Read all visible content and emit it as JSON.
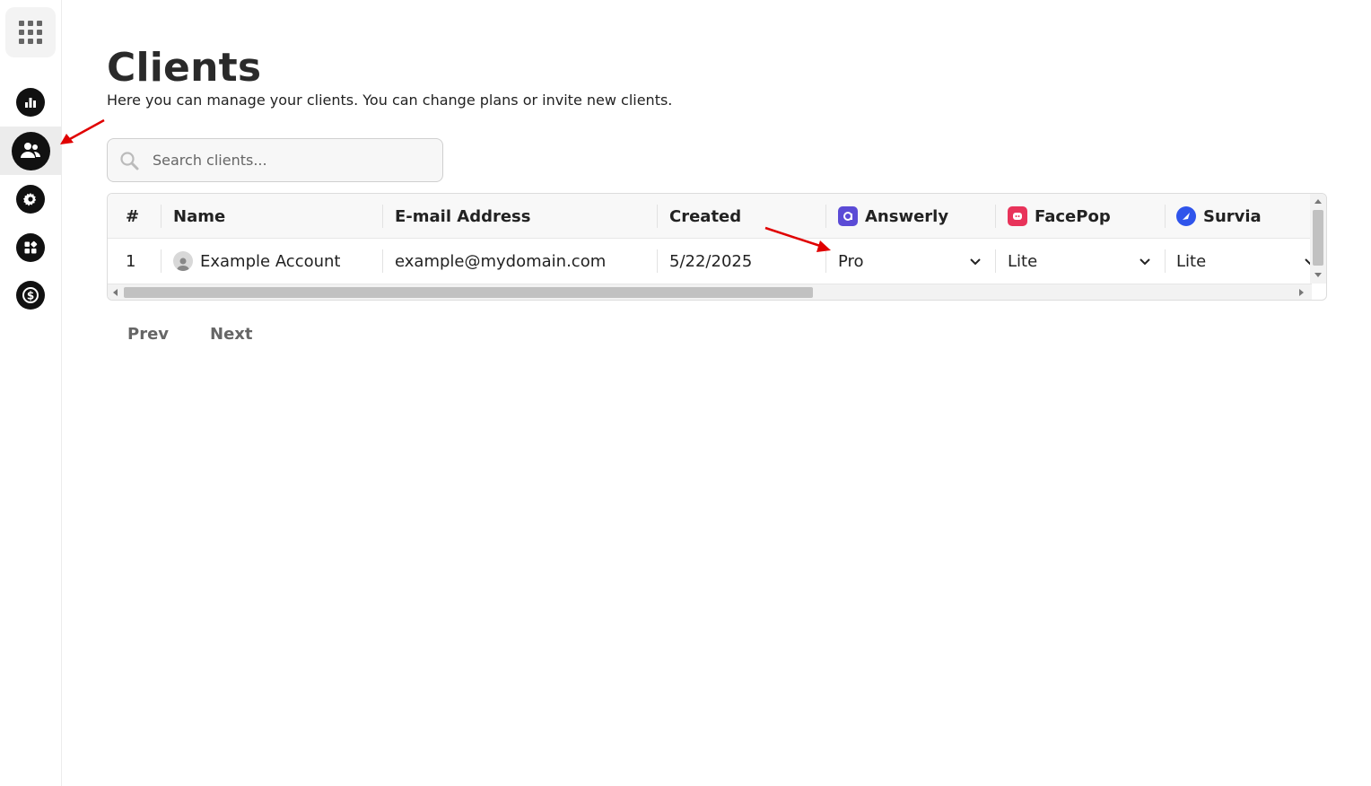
{
  "sidebar": {
    "items": [
      {
        "name": "analytics",
        "icon": "bar-chart-icon"
      },
      {
        "name": "clients",
        "icon": "users-icon",
        "active": true
      },
      {
        "name": "settings",
        "icon": "gear-icon"
      },
      {
        "name": "apps",
        "icon": "widgets-icon"
      },
      {
        "name": "billing",
        "icon": "dollar-icon"
      }
    ]
  },
  "page": {
    "title": "Clients",
    "subtitle": "Here you can manage your clients. You can change plans or invite new clients."
  },
  "search": {
    "placeholder": "Search clients..."
  },
  "table": {
    "headers": {
      "index": "#",
      "name": "Name",
      "email": "E-mail Address",
      "created": "Created",
      "answerly": "Answerly",
      "facepop": "FacePop",
      "survia": "Survia"
    },
    "rows": [
      {
        "index": "1",
        "name": "Example Account",
        "email": "example@mydomain.com",
        "created": "5/22/2025",
        "answerly": "Pro",
        "facepop": "Lite",
        "survia": "Lite"
      }
    ]
  },
  "pager": {
    "prev": "Prev",
    "next": "Next"
  },
  "colors": {
    "answerly": "#5b4bd6",
    "facepop": "#e8335a",
    "survia": "#2f54eb",
    "annotation": "#e00000"
  }
}
